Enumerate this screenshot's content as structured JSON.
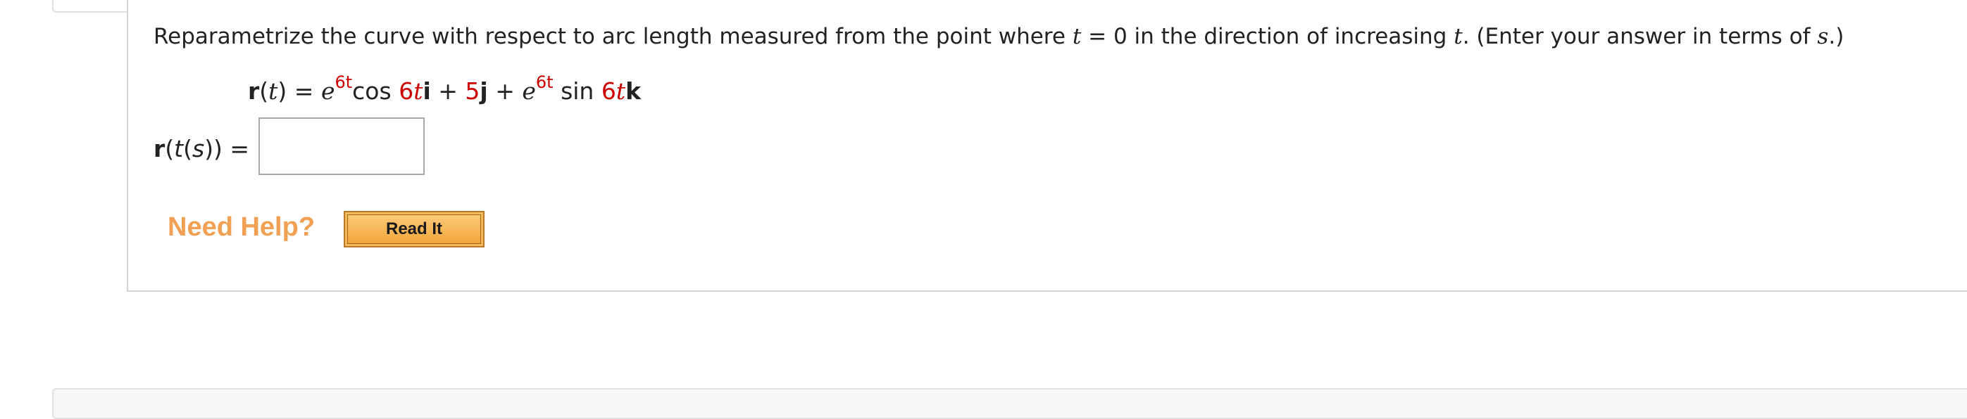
{
  "question": {
    "prompt_part1": "Reparametrize the curve with respect to arc length measured from the point where ",
    "prompt_var_t": "t",
    "prompt_part2": " = 0 in the direction of increasing ",
    "prompt_var_t2": "t",
    "prompt_part3": ". (Enter your answer in terms of ",
    "prompt_var_s": "s",
    "prompt_part4": ".)"
  },
  "formula": {
    "lhs_r": "r",
    "lhs_open": "(",
    "lhs_t": "t",
    "lhs_close": ") = ",
    "e1": "e",
    "exp1": "6t",
    "cos": "cos ",
    "coef1": "6",
    "var1": "t",
    "i": "i",
    "plus1": " + ",
    "coef_j": "5",
    "j": "j",
    "plus2": " + ",
    "e2": "e",
    "exp2": "6t",
    "sin": " sin ",
    "coef2": "6",
    "var2": "t",
    "k": "k"
  },
  "answer": {
    "label_r": "r",
    "label_rest_open": "(",
    "label_t": "t",
    "label_paren": "(",
    "label_s": "s",
    "label_close": "))  =",
    "value": ""
  },
  "help": {
    "need_help": "Need Help?",
    "read_it": "Read It"
  },
  "colors": {
    "accent_red": "#cc0000",
    "need_help_orange": "#f2a154",
    "button_orange": "#f7b85a"
  }
}
